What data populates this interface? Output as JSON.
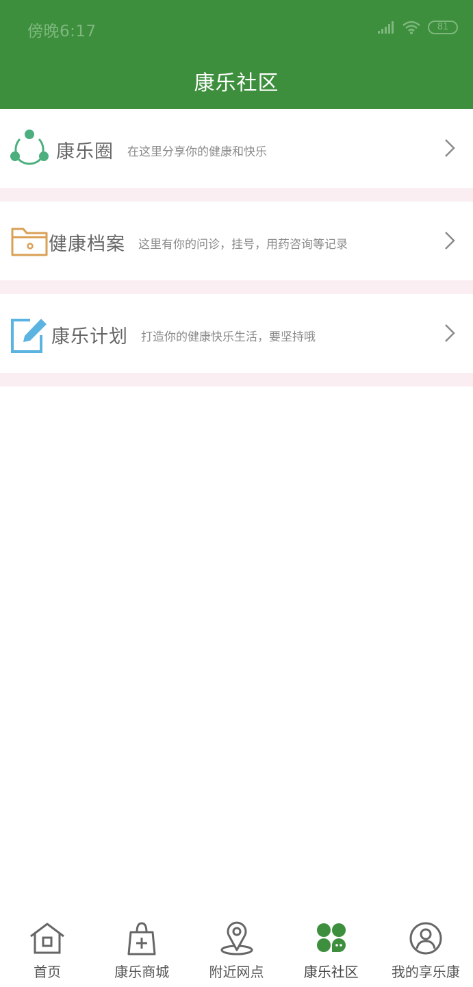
{
  "status_bar": {
    "time": "傍晚6:17",
    "battery": "81",
    "signal_icon": "signal-icon",
    "wifi_icon": "wifi-icon"
  },
  "header": {
    "title": "康乐社区",
    "background_color": "#3d8f3d"
  },
  "menu": [
    {
      "title": "康乐圈",
      "subtitle": "在这里分享你的健康和快乐",
      "icon": "share-circle-icon",
      "icon_color": "#4caf7d"
    },
    {
      "title": "健康档案",
      "subtitle": "这里有你的问诊，挂号，用药咨询等记录",
      "icon": "folder-icon",
      "icon_color": "#d9a056"
    },
    {
      "title": "康乐计划",
      "subtitle": "打造你的健康快乐生活，要坚持哦",
      "icon": "edit-icon",
      "icon_color": "#5ab3e0"
    }
  ],
  "tabbar": {
    "items": [
      {
        "label": "首页",
        "icon": "home-icon",
        "active": false
      },
      {
        "label": "康乐商城",
        "icon": "shopping-bag-icon",
        "active": false
      },
      {
        "label": "附近网点",
        "icon": "location-pin-icon",
        "active": false
      },
      {
        "label": "康乐社区",
        "icon": "community-icon",
        "active": true
      },
      {
        "label": "我的享乐康",
        "icon": "user-icon",
        "active": false
      }
    ],
    "active_color": "#3d8f3d"
  }
}
